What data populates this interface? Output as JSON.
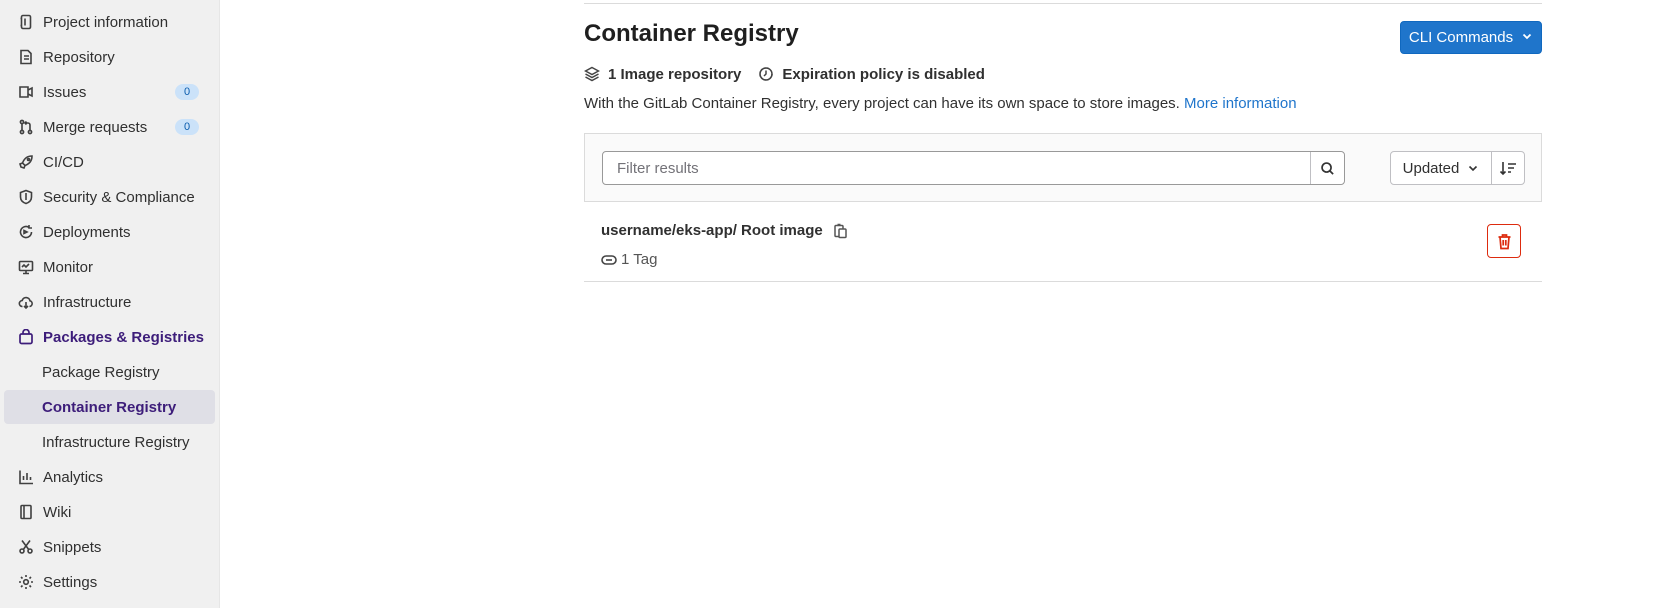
{
  "sidebar": {
    "items": [
      {
        "label": "Project information",
        "icon": "project-information-icon"
      },
      {
        "label": "Repository",
        "icon": "repository-icon"
      },
      {
        "label": "Issues",
        "icon": "issues-icon",
        "badge": "0"
      },
      {
        "label": "Merge requests",
        "icon": "merge-requests-icon",
        "badge": "0"
      },
      {
        "label": "CI/CD",
        "icon": "rocket-icon"
      },
      {
        "label": "Security & Compliance",
        "icon": "shield-icon"
      },
      {
        "label": "Deployments",
        "icon": "deployments-icon"
      },
      {
        "label": "Monitor",
        "icon": "monitor-icon"
      },
      {
        "label": "Infrastructure",
        "icon": "cloud-icon"
      },
      {
        "label": "Packages & Registries",
        "icon": "package-icon"
      },
      {
        "label": "Package Registry"
      },
      {
        "label": "Container Registry"
      },
      {
        "label": "Infrastructure Registry"
      },
      {
        "label": "Analytics",
        "icon": "chart-icon"
      },
      {
        "label": "Wiki",
        "icon": "book-icon"
      },
      {
        "label": "Snippets",
        "icon": "scissors-icon"
      },
      {
        "label": "Settings",
        "icon": "gear-icon"
      }
    ]
  },
  "main": {
    "title": "Container Registry",
    "cli_button": "CLI Commands",
    "meta": {
      "repo_count": "1 Image repository",
      "expiration": "Expiration policy is disabled"
    },
    "description": "With the GitLab Container Registry, every project can have its own space to store images.",
    "more_info_link": "More information",
    "filter": {
      "placeholder": "Filter results",
      "sort_label": "Updated"
    },
    "images": [
      {
        "name": "username/eks-app/ Root image",
        "tags": "1 Tag"
      }
    ]
  },
  "colors": {
    "accent": "#1f75cb",
    "active_nav": "#3d1d7a",
    "danger": "#dd2b0e",
    "sidebar_bg": "#f0f0f0"
  }
}
